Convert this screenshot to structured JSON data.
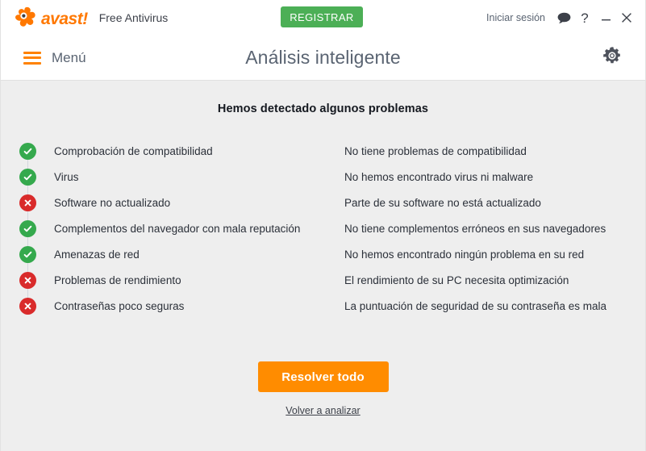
{
  "titlebar": {
    "brand_wordmark": "avast!",
    "product_name": "Free Antivirus",
    "register_label": "REGISTRAR",
    "signin_label": "Iniciar sesión",
    "chat_icon": "speech-bubble-icon",
    "help_icon": "?",
    "minimize_icon": "—",
    "close_icon": "✕"
  },
  "header": {
    "menu_label": "Menú",
    "title": "Análisis inteligente",
    "settings_icon": "gear-icon"
  },
  "main": {
    "result_heading": "Hemos detectado algunos problemas",
    "rows": [
      {
        "status": "ok",
        "label": "Comprobación de compatibilidad",
        "description": "No tiene problemas de compatibilidad"
      },
      {
        "status": "ok",
        "label": "Virus",
        "description": "No hemos encontrado virus ni malware"
      },
      {
        "status": "bad",
        "label": "Software no actualizado",
        "description": "Parte de su software no está actualizado"
      },
      {
        "status": "ok",
        "label": "Complementos del navegador con mala reputación",
        "description": "No tiene complementos erróneos en sus navegadores"
      },
      {
        "status": "ok",
        "label": "Amenazas de red",
        "description": "No hemos encontrado ningún problema en su red"
      },
      {
        "status": "bad",
        "label": "Problemas de rendimiento",
        "description": "El rendimiento de su PC necesita optimización"
      },
      {
        "status": "bad",
        "label": "Contraseñas poco seguras",
        "description": "La puntuación de seguridad de su contraseña es mala"
      }
    ],
    "resolve_label": "Resolver todo",
    "rescan_label": "Volver a analizar"
  },
  "colors": {
    "brand_orange": "#ff8200",
    "action_orange": "#ff8c00",
    "register_green": "#4caf56",
    "status_ok_green": "#35a94d",
    "status_bad_red": "#d92b2b",
    "page_background": "#eeeeee",
    "header_background": "#ffffff",
    "text_primary": "#2b3039",
    "text_muted": "#5a6472"
  }
}
